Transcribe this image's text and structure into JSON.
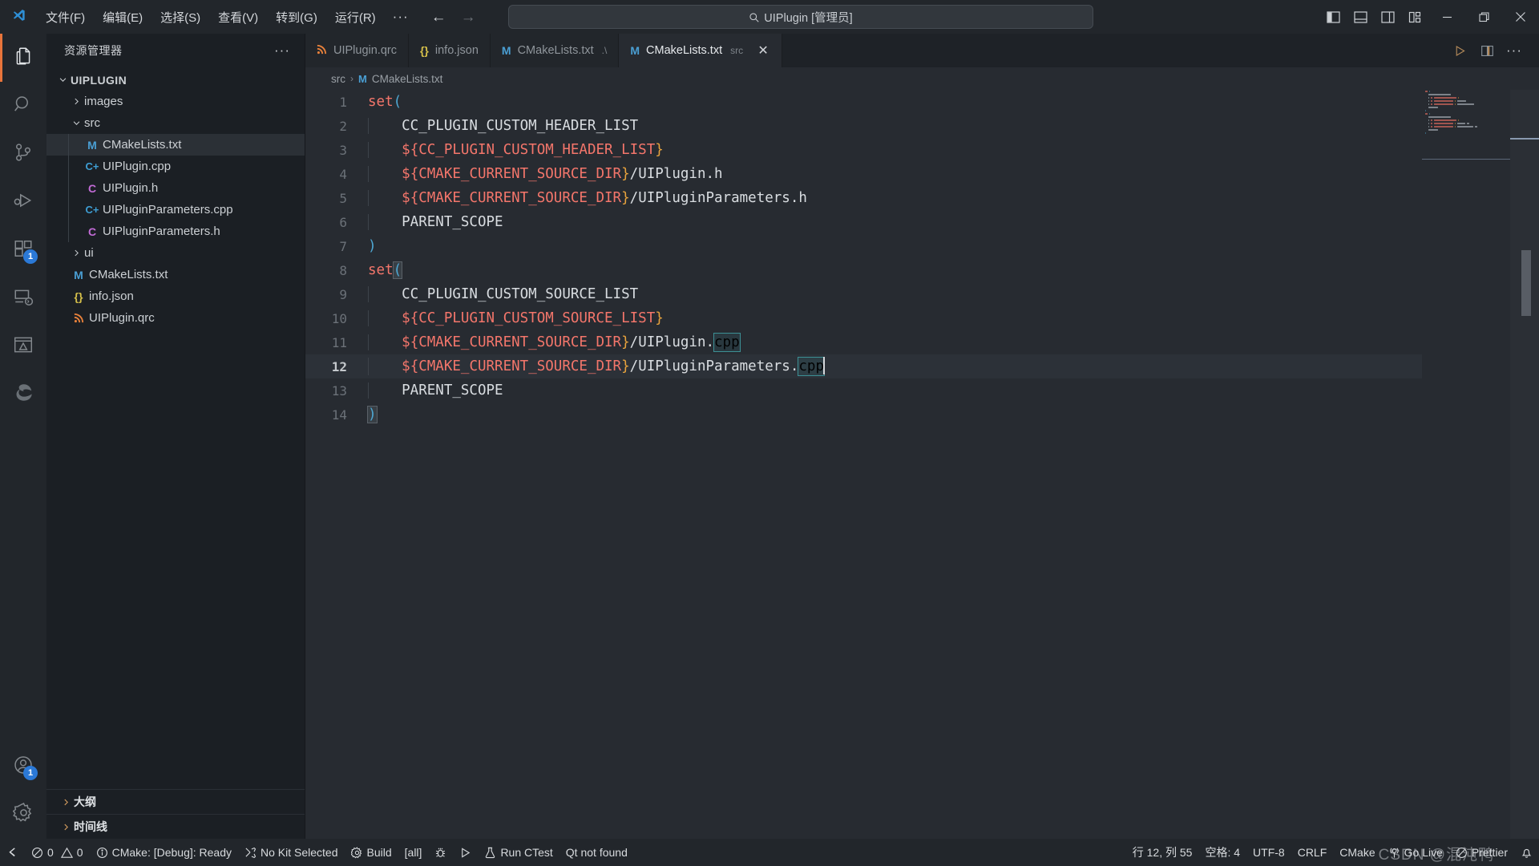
{
  "window": {
    "title": "UIPlugin [管理员]",
    "search_placeholder": "UIPlugin [管理员]",
    "logo_icon": "vscode-logo-icon"
  },
  "menu": {
    "items": [
      {
        "label": "文件(F)",
        "name": "menu-file"
      },
      {
        "label": "编辑(E)",
        "name": "menu-edit"
      },
      {
        "label": "选择(S)",
        "name": "menu-selection"
      },
      {
        "label": "查看(V)",
        "name": "menu-view"
      },
      {
        "label": "转到(G)",
        "name": "menu-go"
      },
      {
        "label": "运行(R)",
        "name": "menu-run"
      }
    ],
    "more": "···"
  },
  "nav": {
    "back": "←",
    "forward": "→"
  },
  "layout_controls": [
    {
      "name": "toggle-primary-sidebar-icon",
      "label": "toggle-primary-sidebar"
    },
    {
      "name": "toggle-panel-icon",
      "label": "toggle-panel"
    },
    {
      "name": "toggle-secondary-sidebar-icon",
      "label": "toggle-secondary-sidebar"
    },
    {
      "name": "customize-layout-icon",
      "label": "customize-layout"
    }
  ],
  "window_controls": [
    {
      "name": "minimize-button",
      "glyph": "—"
    },
    {
      "name": "maximize-button",
      "glyph": "❐"
    },
    {
      "name": "close-button",
      "glyph": "✕"
    }
  ],
  "activitybar": {
    "items": [
      {
        "name": "activity-explorer",
        "icon": "files-icon",
        "active": true,
        "badge": null
      },
      {
        "name": "activity-search",
        "icon": "search-icon",
        "active": false,
        "badge": null
      },
      {
        "name": "activity-source-control",
        "icon": "source-control-icon",
        "active": false,
        "badge": null
      },
      {
        "name": "activity-run-debug",
        "icon": "run-and-debug-icon",
        "active": false,
        "badge": null
      },
      {
        "name": "activity-extensions",
        "icon": "extensions-icon",
        "active": false,
        "badge": "1"
      },
      {
        "name": "activity-remote-explorer",
        "icon": "remote-explorer-icon",
        "active": false,
        "badge": null
      },
      {
        "name": "activity-cmake",
        "icon": "cmake-icon",
        "active": false,
        "badge": null
      },
      {
        "name": "activity-edge-tools",
        "icon": "edge-browser-icon",
        "active": false,
        "badge": null
      }
    ],
    "bottom": [
      {
        "name": "activity-accounts",
        "icon": "account-icon",
        "badge": "1"
      },
      {
        "name": "activity-settings",
        "icon": "gear-icon",
        "badge": null
      }
    ]
  },
  "sidebar": {
    "title": "资源管理器",
    "more_actions": "···",
    "tree": [
      {
        "name": "tree-root-uiplugin",
        "label": "UIPLUGIN",
        "depth": 0,
        "kind": "root",
        "expanded": true,
        "icon": null,
        "selected": false
      },
      {
        "name": "tree-folder-images",
        "label": "images",
        "depth": 1,
        "kind": "folder",
        "expanded": false,
        "icon": null,
        "selected": false
      },
      {
        "name": "tree-folder-src",
        "label": "src",
        "depth": 1,
        "kind": "folder",
        "expanded": true,
        "icon": null,
        "selected": false
      },
      {
        "name": "tree-file-src-cmakelists",
        "label": "CMakeLists.txt",
        "depth": 2,
        "kind": "file",
        "icon": "M",
        "icon_color": "#4a9fd4",
        "selected": true
      },
      {
        "name": "tree-file-uiplugin-cpp",
        "label": "UIPlugin.cpp",
        "depth": 2,
        "kind": "file",
        "icon": "C+",
        "icon_color": "#3e9ed4",
        "selected": false
      },
      {
        "name": "tree-file-uiplugin-h",
        "label": "UIPlugin.h",
        "depth": 2,
        "kind": "file",
        "icon": "C",
        "icon_color": "#c26bd6",
        "selected": false
      },
      {
        "name": "tree-file-uipluginparameters-cpp",
        "label": "UIPluginParameters.cpp",
        "depth": 2,
        "kind": "file",
        "icon": "C+",
        "icon_color": "#3e9ed4",
        "selected": false
      },
      {
        "name": "tree-file-uipluginparameters-h",
        "label": "UIPluginParameters.h",
        "depth": 2,
        "kind": "file",
        "icon": "C",
        "icon_color": "#c26bd6",
        "selected": false
      },
      {
        "name": "tree-folder-ui",
        "label": "ui",
        "depth": 1,
        "kind": "folder",
        "expanded": false,
        "icon": null,
        "selected": false
      },
      {
        "name": "tree-file-root-cmakelists",
        "label": "CMakeLists.txt",
        "depth": 1,
        "kind": "file",
        "icon": "M",
        "icon_color": "#4a9fd4",
        "selected": false
      },
      {
        "name": "tree-file-info-json",
        "label": "info.json",
        "depth": 1,
        "kind": "file",
        "icon": "{}",
        "icon_color": "#d6c04a",
        "selected": false
      },
      {
        "name": "tree-file-uiplugin-qrc",
        "label": "UIPlugin.qrc",
        "depth": 1,
        "kind": "file",
        "icon": "qrc",
        "icon_color": "#e8813b",
        "selected": false
      }
    ],
    "panels": [
      {
        "name": "sidebar-panel-outline",
        "label": "大纲"
      },
      {
        "name": "sidebar-panel-timeline",
        "label": "时间线"
      }
    ]
  },
  "tabs": [
    {
      "name": "tab-uiplugin-qrc",
      "label": "UIPlugin.qrc",
      "icon": "qrc",
      "icon_color": "#e8813b",
      "desc": "",
      "active": false,
      "closable": false
    },
    {
      "name": "tab-info-json",
      "label": "info.json",
      "icon": "{}",
      "icon_color": "#d6c04a",
      "desc": "",
      "active": false,
      "closable": false
    },
    {
      "name": "tab-cmakelists-root",
      "label": "CMakeLists.txt",
      "icon": "M",
      "icon_color": "#4a9fd4",
      "desc": ".\\",
      "active": false,
      "closable": false
    },
    {
      "name": "tab-cmakelists-src",
      "label": "CMakeLists.txt",
      "icon": "M",
      "icon_color": "#4a9fd4",
      "desc": "src",
      "active": true,
      "closable": true,
      "close_glyph": "✕"
    }
  ],
  "editor_actions": [
    {
      "name": "run-code-button",
      "icon": "play-icon"
    },
    {
      "name": "split-editor-right-button",
      "icon": "split-editor-icon"
    },
    {
      "name": "editor-more-actions-button",
      "icon": "ellipsis-icon"
    }
  ],
  "breadcrumb": {
    "folder": "src",
    "sep": "›",
    "file_icon": "M",
    "file": "CMakeLists.txt"
  },
  "editor": {
    "language": "CMake",
    "lines": [
      {
        "n": 1,
        "tokens": [
          {
            "t": "set",
            "c": "fn"
          },
          {
            "t": "(",
            "c": "paren"
          }
        ]
      },
      {
        "n": 2,
        "tokens": [
          {
            "t": "    CC_PLUGIN_CUSTOM_HEADER_LIST",
            "c": "text"
          }
        ]
      },
      {
        "n": 3,
        "tokens": [
          {
            "t": "    ",
            "c": "text"
          },
          {
            "t": "${",
            "c": "var"
          },
          {
            "t": "CC_PLUGIN_CUSTOM_HEADER_LIST",
            "c": "var"
          },
          {
            "t": "}",
            "c": "brace"
          }
        ]
      },
      {
        "n": 4,
        "tokens": [
          {
            "t": "    ",
            "c": "text"
          },
          {
            "t": "${",
            "c": "var"
          },
          {
            "t": "CMAKE_CURRENT_SOURCE_DIR",
            "c": "var"
          },
          {
            "t": "}",
            "c": "brace"
          },
          {
            "t": "/UIPlugin.h",
            "c": "path"
          }
        ]
      },
      {
        "n": 5,
        "tokens": [
          {
            "t": "    ",
            "c": "text"
          },
          {
            "t": "${",
            "c": "var"
          },
          {
            "t": "CMAKE_CURRENT_SOURCE_DIR",
            "c": "var"
          },
          {
            "t": "}",
            "c": "brace"
          },
          {
            "t": "/UIPluginParameters.h",
            "c": "path"
          }
        ]
      },
      {
        "n": 6,
        "tokens": [
          {
            "t": "    PARENT_SCOPE",
            "c": "text"
          }
        ]
      },
      {
        "n": 7,
        "tokens": [
          {
            "t": ")",
            "c": "paren"
          }
        ]
      },
      {
        "n": 8,
        "tokens": [
          {
            "t": "set",
            "c": "fn"
          },
          {
            "t": "(",
            "c": "paren-match"
          }
        ]
      },
      {
        "n": 9,
        "tokens": [
          {
            "t": "    CC_PLUGIN_CUSTOM_SOURCE_LIST",
            "c": "text"
          }
        ]
      },
      {
        "n": 10,
        "tokens": [
          {
            "t": "    ",
            "c": "text"
          },
          {
            "t": "${",
            "c": "var"
          },
          {
            "t": "CC_PLUGIN_CUSTOM_SOURCE_LIST",
            "c": "var"
          },
          {
            "t": "}",
            "c": "brace"
          }
        ]
      },
      {
        "n": 11,
        "tokens": [
          {
            "t": "    ",
            "c": "text"
          },
          {
            "t": "${",
            "c": "var"
          },
          {
            "t": "CMAKE_CURRENT_SOURCE_DIR",
            "c": "var"
          },
          {
            "t": "}",
            "c": "brace"
          },
          {
            "t": "/UIPlugin.",
            "c": "path"
          },
          {
            "t": "cpp",
            "c": "occ"
          }
        ]
      },
      {
        "n": 12,
        "tokens": [
          {
            "t": "    ",
            "c": "text"
          },
          {
            "t": "${",
            "c": "var"
          },
          {
            "t": "CMAKE_CURRENT_SOURCE_DIR",
            "c": "var"
          },
          {
            "t": "}",
            "c": "brace"
          },
          {
            "t": "/UIPluginParameters.",
            "c": "path"
          },
          {
            "t": "cpp",
            "c": "occ"
          },
          {
            "t": "",
            "c": "caret"
          }
        ],
        "current": true
      },
      {
        "n": 13,
        "tokens": [
          {
            "t": "    PARENT_SCOPE",
            "c": "text"
          }
        ]
      },
      {
        "n": 14,
        "tokens": [
          {
            "t": ")",
            "c": "paren-match"
          }
        ]
      }
    ]
  },
  "statusbar": {
    "left": [
      {
        "name": "status-remote-indicator",
        "icon": "remote-icon",
        "label": ""
      },
      {
        "name": "status-problems",
        "icon": "error-warning-icon",
        "label": "0  0",
        "errors": "0",
        "warnings": "0"
      },
      {
        "name": "status-cmake-status",
        "icon": "info-icon",
        "label": "CMake: [Debug]: Ready"
      },
      {
        "name": "status-kit-selector",
        "icon": "tools-icon",
        "label": "No Kit Selected"
      },
      {
        "name": "status-build",
        "icon": "gear-icon",
        "label": "Build"
      },
      {
        "name": "status-build-target",
        "icon": "",
        "label": "[all]"
      },
      {
        "name": "status-debug-target",
        "icon": "bug-icon",
        "label": ""
      },
      {
        "name": "status-launch-target",
        "icon": "play-icon",
        "label": ""
      },
      {
        "name": "status-run-ctest",
        "icon": "beaker-icon",
        "label": "Run CTest"
      },
      {
        "name": "status-qt-status",
        "icon": "",
        "label": "Qt not found"
      }
    ],
    "right": [
      {
        "name": "status-cursor-position",
        "icon": "",
        "label": "行 12, 列 55"
      },
      {
        "name": "status-indentation",
        "icon": "",
        "label": "空格: 4"
      },
      {
        "name": "status-encoding",
        "icon": "",
        "label": "UTF-8"
      },
      {
        "name": "status-eol",
        "icon": "",
        "label": "CRLF"
      },
      {
        "name": "status-language-mode",
        "icon": "",
        "label": "CMake"
      },
      {
        "name": "status-go-live",
        "icon": "broadcast-icon",
        "label": "Go Live"
      },
      {
        "name": "status-prettier",
        "icon": "prettier-icon",
        "label": "Prettier"
      },
      {
        "name": "status-bell",
        "icon": "bell-icon",
        "label": ""
      }
    ],
    "watermark": "CSDN @混沌鸭"
  },
  "colors": {
    "titlebar_bg": "#22262b",
    "activitybar_bg": "#22262b",
    "sidebar_bg": "#1b1f24",
    "editor_bg": "#272b31",
    "statusbar_bg": "#22262b",
    "accent": "#e8743b",
    "badge": "#2b79d7",
    "keyword": "#f4766b",
    "brace": "#e8a33d",
    "paren": "#4ea8d4",
    "text": "#d9dde1",
    "linenum": "#6b7178",
    "occurrence_outline": "#3c8f94"
  },
  "chart_data": null
}
